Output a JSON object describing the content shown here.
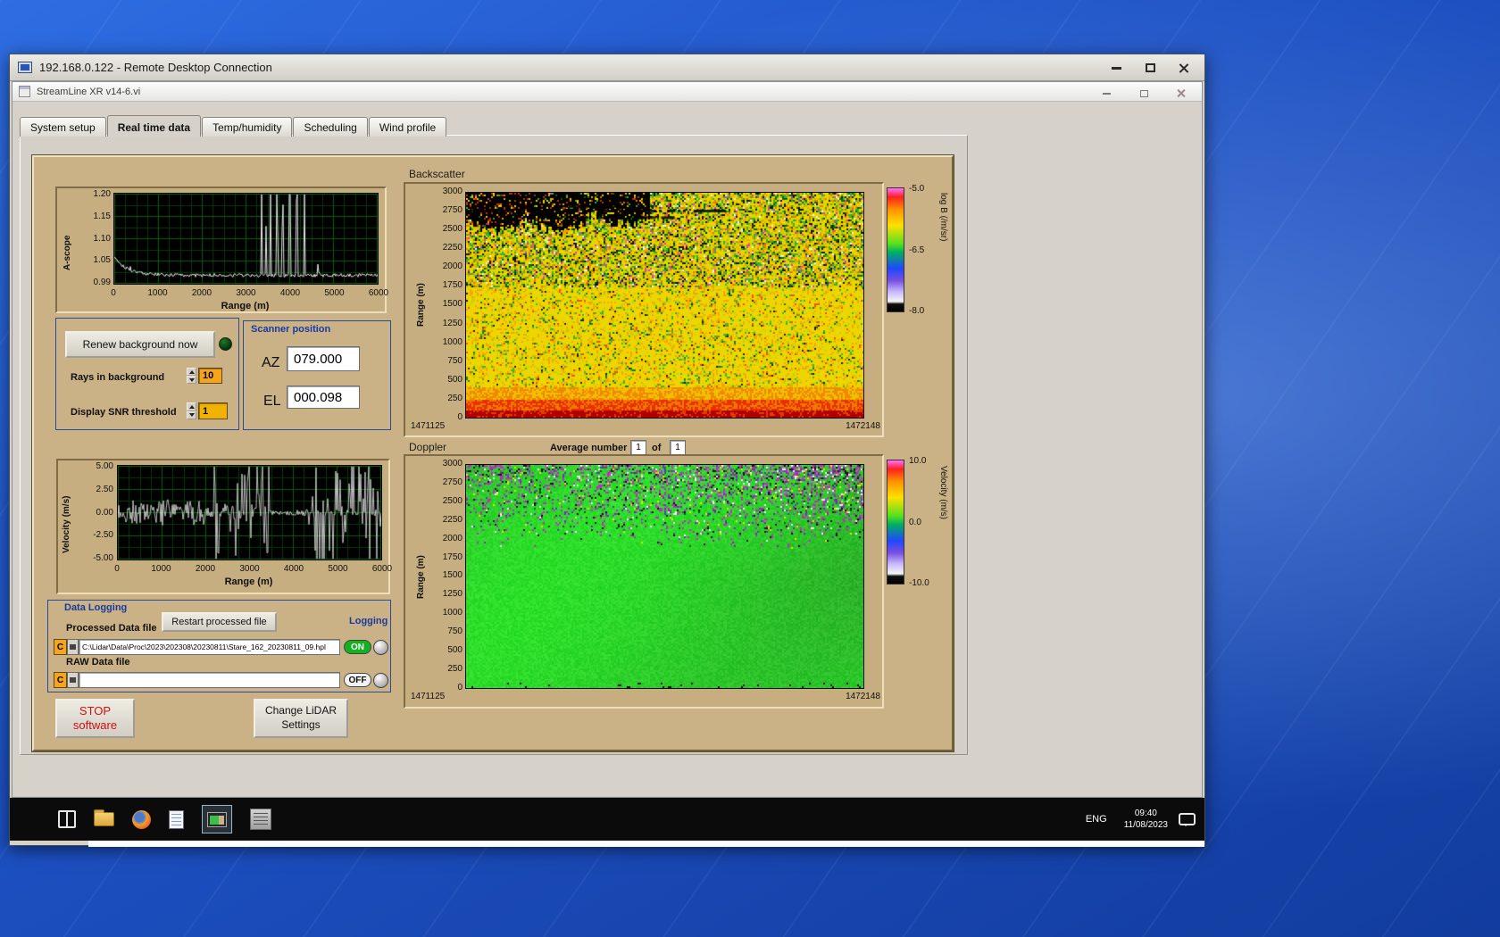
{
  "colors": {
    "accent_blue": "#1a3aa0",
    "panel_tan": "#cbb286",
    "toggle_on_green": "#14b024",
    "stop_red": "#cc1111"
  },
  "rdp": {
    "title": "192.168.0.122 - Remote Desktop Connection"
  },
  "app": {
    "title": "StreamLine XR v14-6.vi",
    "tabs": [
      "System setup",
      "Real time data",
      "Temp/humidity",
      "Scheduling",
      "Wind profile"
    ],
    "active_tab_index": 1
  },
  "ascope": {
    "ylabel": "A-scope",
    "xlabel": "Range (m)",
    "yticks": [
      "1.20",
      "1.15",
      "1.10",
      "1.05",
      "0.99"
    ],
    "xticks": [
      "0",
      "1000",
      "2000",
      "3000",
      "4000",
      "5000",
      "6000"
    ]
  },
  "background_controls": {
    "renew_button": "Renew background now",
    "rays_label": "Rays in background",
    "rays_value": "10",
    "snr_label": "Display SNR threshold",
    "snr_value": "1"
  },
  "scanner": {
    "title": "Scanner position",
    "az_label": "AZ",
    "az_value": "079.000",
    "el_label": "EL",
    "el_value": "000.098"
  },
  "backscatter": {
    "title": "Backscatter",
    "ylabel": "Range (m)",
    "yticks": [
      "3000",
      "2750",
      "2500",
      "2250",
      "2000",
      "1750",
      "1500",
      "1250",
      "1000",
      "750",
      "500",
      "250",
      "0"
    ],
    "x_start": "1471125",
    "x_end": "1472148",
    "colorbar": {
      "ticks": [
        "-5.0",
        "-6.5",
        "-8.0"
      ],
      "label": "log B (/m/sr)"
    }
  },
  "doppler": {
    "title": "Doppler",
    "avg_label": "Average number",
    "avg_value": "1",
    "of_label": "of",
    "avg_total": "1",
    "ylabel": "Range (m)",
    "yticks": [
      "3000",
      "2750",
      "2500",
      "2250",
      "2000",
      "1750",
      "1500",
      "1250",
      "1000",
      "750",
      "500",
      "250",
      "0"
    ],
    "x_start": "1471125",
    "x_end": "1472148",
    "colorbar": {
      "ticks": [
        "10.0",
        "0.0",
        "-10.0"
      ],
      "label": "Velocity (m/s)"
    }
  },
  "velocity_plot": {
    "ylabel": "Velocity (m/s)",
    "xlabel": "Range (m)",
    "yticks": [
      "5.00",
      "2.50",
      "0.00",
      "-2.50",
      "-5.00"
    ],
    "xticks": [
      "0",
      "1000",
      "2000",
      "3000",
      "4000",
      "5000",
      "6000"
    ]
  },
  "data_logging": {
    "title": "Data Logging",
    "processed_label": "Processed Data file",
    "restart_button": "Restart processed file",
    "logging_label": "Logging",
    "drive_letter": "C",
    "processed_path": "C:\\Lidar\\Data\\Proc\\2023\\202308\\20230811\\Stare_162_20230811_09.hpl",
    "processed_state": "ON",
    "raw_label": "RAW Data file",
    "raw_path": "",
    "raw_state": "OFF"
  },
  "footer": {
    "stop_line1": "STOP",
    "stop_line2": "software",
    "settings_line1": "Change LiDAR",
    "settings_line2": "Settings"
  },
  "taskbar": {
    "lang": "ENG",
    "time": "09:40",
    "date": "11/08/2023"
  }
}
